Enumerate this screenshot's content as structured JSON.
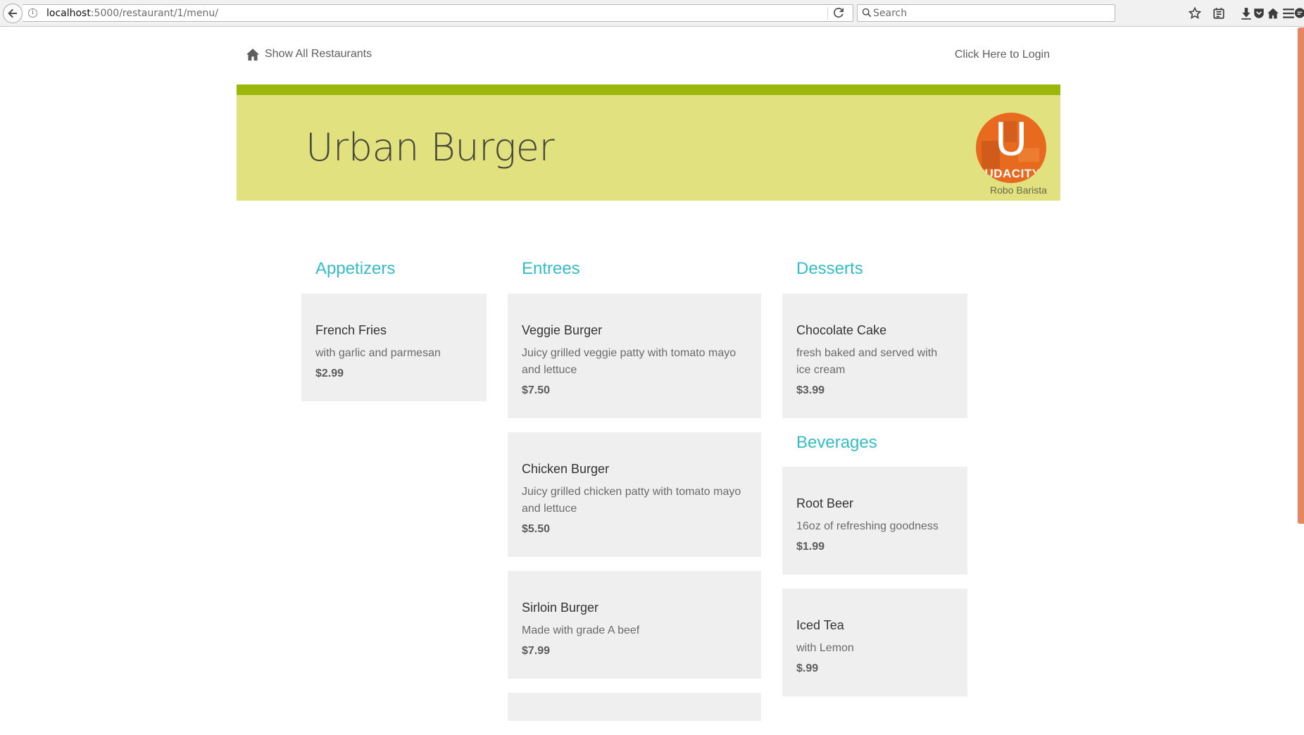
{
  "browser": {
    "url_host": "localhost",
    "url_rest": ":5000/restaurant/1/menu/",
    "search_placeholder": "Search",
    "icons": [
      "back-arrow-icon",
      "info-icon",
      "reload-icon",
      "search-icon",
      "bookmark-star-icon",
      "reading-list-icon",
      "download-icon",
      "home-icon",
      "chat-icon",
      "pocket-icon",
      "menu-icon"
    ]
  },
  "nav": {
    "home_label": "Show All Restaurants",
    "login_label": "Click Here to Login"
  },
  "banner": {
    "restaurant_name": "Urban Burger",
    "avatar_letter": "U",
    "avatar_text": "UDACITY",
    "avatar_caption": "Robo Barista",
    "colors": {
      "stripe": "#9bb709",
      "background": "#e1e17f",
      "avatar": "#e76a1f"
    }
  },
  "menu": {
    "appetizers": {
      "title": "Appetizers",
      "items": [
        {
          "name": "French Fries",
          "description": "with garlic and parmesan",
          "price": "$2.99"
        }
      ]
    },
    "entrees": {
      "title": "Entrees",
      "items": [
        {
          "name": "Veggie Burger",
          "description": "Juicy grilled veggie patty with tomato mayo and lettuce",
          "price": "$7.50"
        },
        {
          "name": "Chicken Burger",
          "description": "Juicy grilled chicken patty with tomato mayo and lettuce",
          "price": "$5.50"
        },
        {
          "name": "Sirloin Burger",
          "description": "Made with grade A beef",
          "price": "$7.99"
        }
      ]
    },
    "desserts": {
      "title": "Desserts",
      "items": [
        {
          "name": "Chocolate Cake",
          "description": "fresh baked and served with ice cream",
          "price": "$3.99"
        }
      ]
    },
    "beverages": {
      "title": "Beverages",
      "items": [
        {
          "name": "Root Beer",
          "description": "16oz of refreshing goodness",
          "price": "$1.99"
        },
        {
          "name": "Iced Tea",
          "description": "with Lemon",
          "price": "$.99"
        }
      ]
    }
  },
  "colors": {
    "section_title": "#35bdc5",
    "card_bg": "#efefef",
    "scrollbar": "#e78660"
  }
}
